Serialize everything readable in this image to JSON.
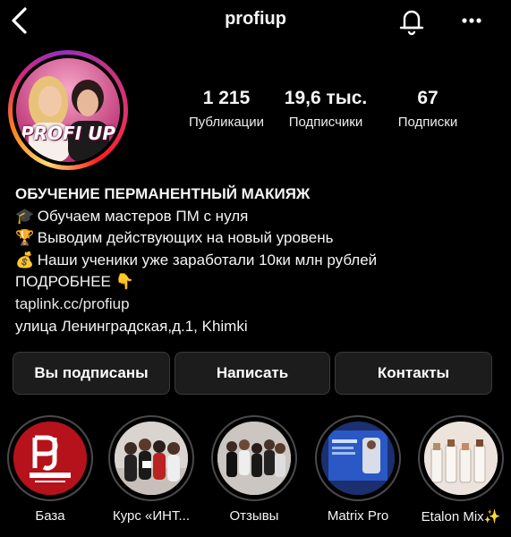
{
  "header": {
    "username": "profiup"
  },
  "avatar": {
    "logo_text": "PROFI UP"
  },
  "stats": [
    {
      "value": "1 215",
      "label": "Публикации"
    },
    {
      "value": "19,6 тыс.",
      "label": "Подписчики"
    },
    {
      "value": "67",
      "label": "Подписки"
    }
  ],
  "bio": {
    "name": "ОБУЧЕНИЕ ПЕРМАНЕНТНЫЙ МАКИЯЖ",
    "lines": [
      {
        "emoji": "🎓",
        "text": "Обучаем мастеров ПМ с нуля"
      },
      {
        "emoji": "🏆",
        "text": "Выводим действующих на новый уровень"
      },
      {
        "emoji": "💰",
        "text": "Наши ученики уже заработали 10ки млн рублей"
      }
    ],
    "more": "ПОДРОБНЕЕ",
    "more_emoji": "👇",
    "link": "taplink.cc/profiup",
    "address": "улица Ленинградская,д.1, Khimki"
  },
  "buttons": {
    "following": "Вы подписаны",
    "message": "Написать",
    "contacts": "Контакты"
  },
  "highlights": [
    {
      "label": "База",
      "icon": "profi-up-logo"
    },
    {
      "label": "Курс «ИНТ...",
      "icon": "group-photo"
    },
    {
      "label": "Отзывы",
      "icon": "students-photo"
    },
    {
      "label": "Matrix Pro",
      "icon": "screen-photo"
    },
    {
      "label": "Etalon Mix✨",
      "icon": "bottles-photo"
    }
  ],
  "colors": {
    "background": "#000000",
    "button_bg": "#1c1c1c",
    "text": "#f5f5f5"
  }
}
